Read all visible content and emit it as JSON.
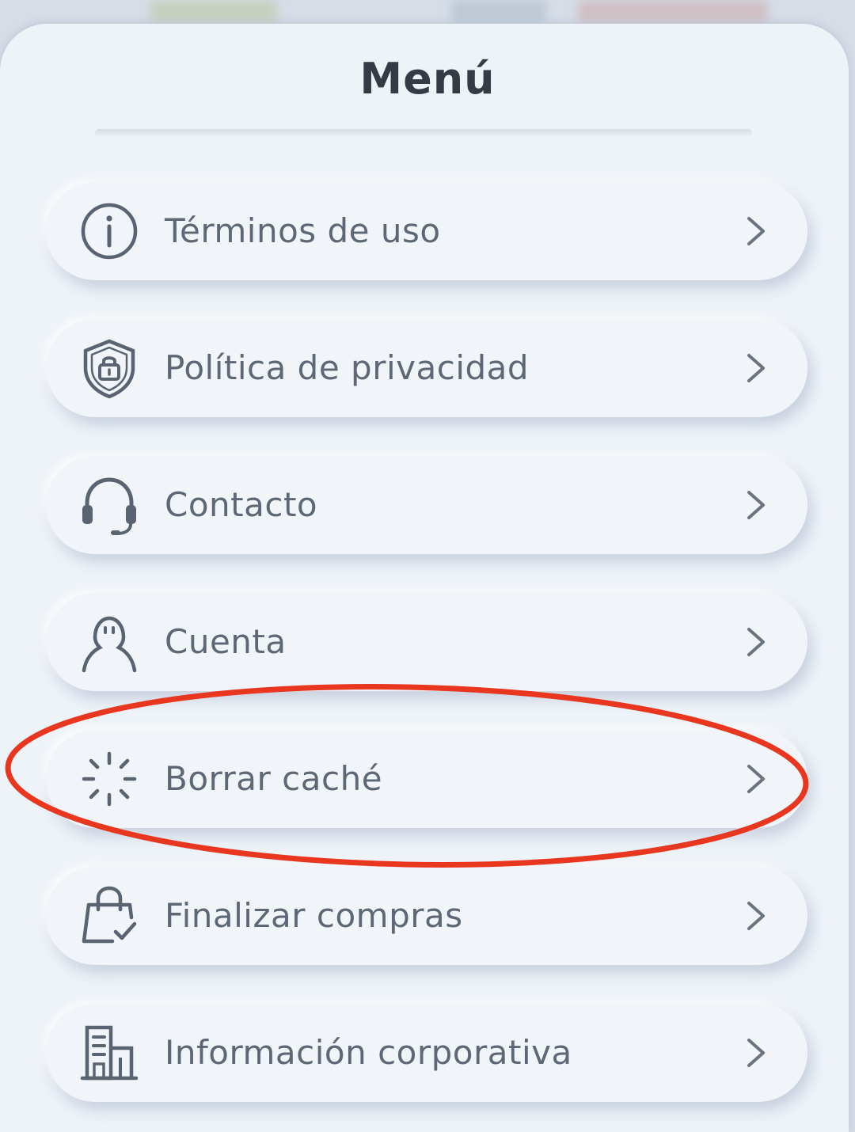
{
  "menu": {
    "title": "Menú",
    "items": [
      {
        "label": "Términos de uso",
        "icon": "info-icon"
      },
      {
        "label": "Política de privacidad",
        "icon": "shield-lock-icon"
      },
      {
        "label": "Contacto",
        "icon": "headset-icon"
      },
      {
        "label": "Cuenta",
        "icon": "user-icon"
      },
      {
        "label": "Borrar caché",
        "icon": "loading-spinner-icon"
      },
      {
        "label": "Finalizar compras",
        "icon": "shopping-bag-check-icon"
      },
      {
        "label": "Información corporativa",
        "icon": "building-icon"
      }
    ],
    "highlighted_item": "Borrar caché"
  },
  "colors": {
    "panel_background": "#eef3f8",
    "title_text": "#353b45",
    "item_text": "#5e6776",
    "icon_stroke": "#5a6372",
    "highlight_ring": "#e8361f"
  }
}
